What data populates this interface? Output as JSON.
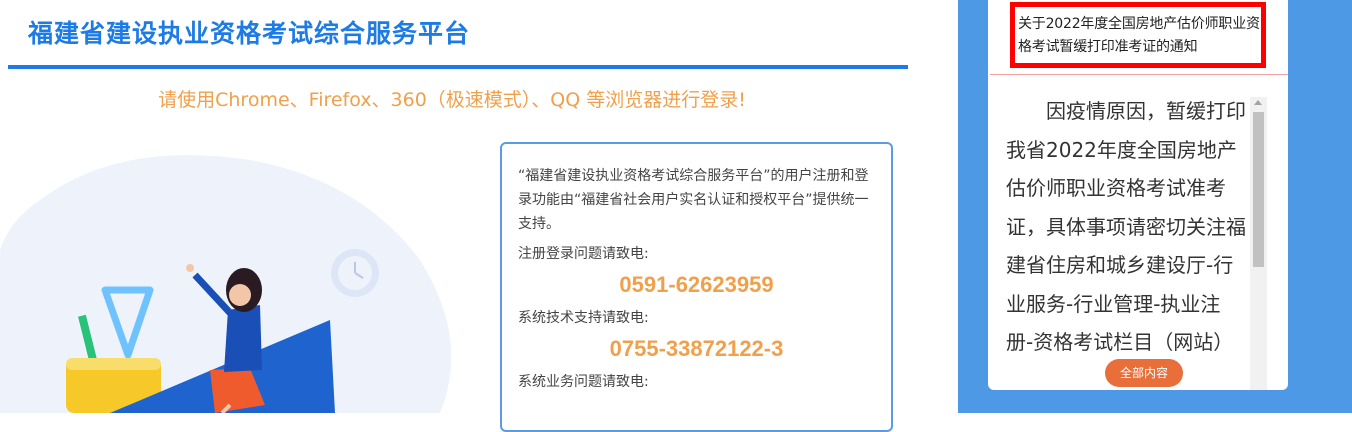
{
  "header": {
    "title": "福建省建设执业资格考试综合服务平台",
    "browser_notice": "请使用Chrome、Firefox、360（极速模式）、QQ 等浏览器进行登录!"
  },
  "info_box": {
    "description": "“福建省建设执业资格考试综合服务平台”的用户注册和登录功能由“福建省社会用户实名认证和授权平台”提供统一支持。",
    "contacts": [
      {
        "label": "注册登录问题请致电:",
        "phone": "0591-62623959"
      },
      {
        "label": "系统技术支持请致电:",
        "phone": "0755-33872122-3"
      },
      {
        "label": "系统业务问题请致电:",
        "phone": ""
      }
    ]
  },
  "notice": {
    "title": "关于2022年度全国房地产估价师职业资格考试暂缓打印准考证的通知",
    "body": "因疫情原因，暂缓打印我省2022年度全国房地产估价师职业资格考试准考证，具体事项请密切关注福建省住房和城乡建设厅-行业服务-行业管理-执业注册-资格考试栏目（网站）",
    "all_content_label": "全部内容"
  },
  "colors": {
    "brand_blue": "#1e7be6",
    "accent_orange": "#f0a04b",
    "panel_blue": "#4d99e6",
    "highlight_red": "#ff0000",
    "button_orange": "#e86f3a"
  }
}
